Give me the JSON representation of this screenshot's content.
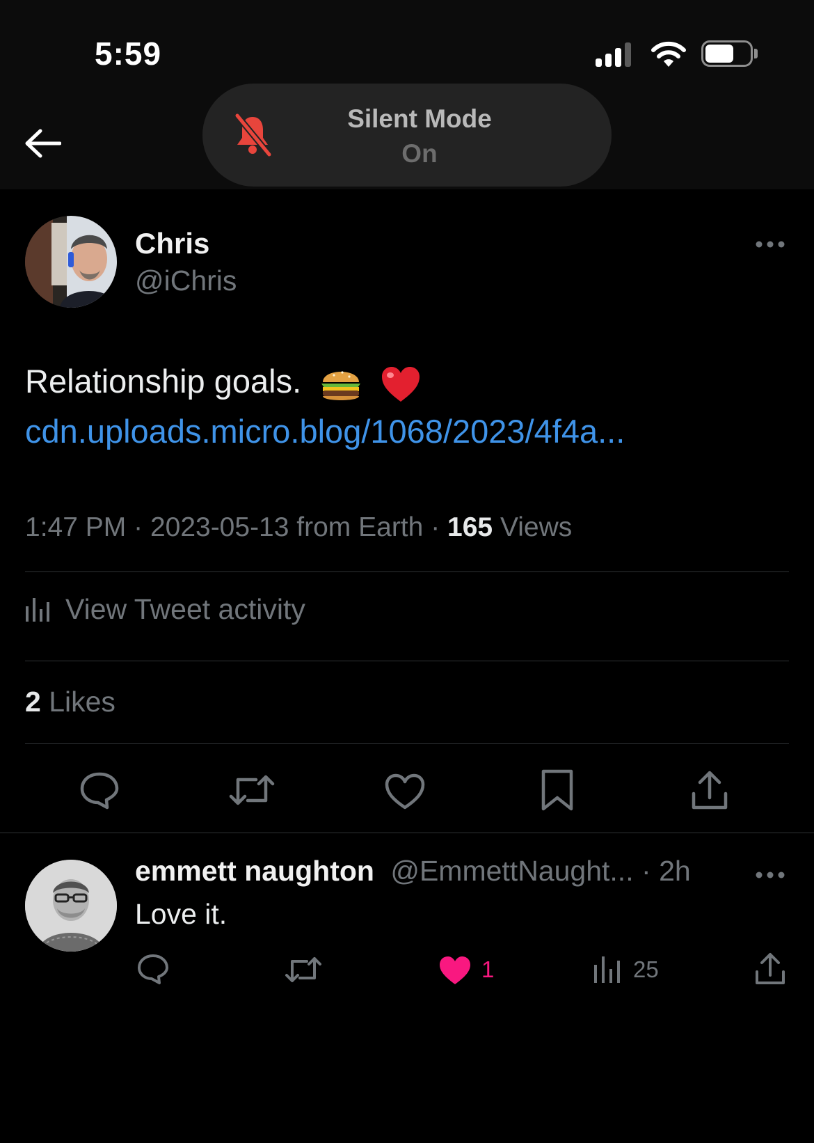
{
  "status_bar": {
    "time": "5:59",
    "icons": [
      "cellular-signal-icon",
      "wifi-icon",
      "battery-icon"
    ],
    "battery_level": 0.65
  },
  "silent_mode": {
    "title": "Silent Mode",
    "state": "On",
    "icon": "bell-slash-icon",
    "icon_color": "#e8453c"
  },
  "header": {
    "back_icon": "back-arrow-icon"
  },
  "tweet": {
    "author_name": "Chris",
    "author_handle": "@iChris",
    "text": "Relationship goals.",
    "emojis": [
      "hamburger",
      "red-heart"
    ],
    "link": "cdn.uploads.micro.blog/1068/2023/4f4a...",
    "link_color": "#3f93e8",
    "time": "1:47 PM",
    "dot": "·",
    "date": "2023-05-13",
    "source": "from Earth",
    "views_count": "165",
    "views_label": "Views",
    "activity_label": "View Tweet activity",
    "likes_count": "2",
    "likes_label": "Likes",
    "actions": [
      "reply-icon",
      "retweet-icon",
      "like-icon",
      "bookmark-icon",
      "share-icon"
    ]
  },
  "reply": {
    "name": "emmett naughton",
    "handle": "@EmmettNaught...",
    "dot": "·",
    "time": "2h",
    "text": "Love it.",
    "like_count": "1",
    "like_color": "#f91880",
    "views_count": "25",
    "actions": [
      "reply-icon",
      "retweet-icon",
      "like-icon",
      "views-icon",
      "share-icon"
    ]
  }
}
